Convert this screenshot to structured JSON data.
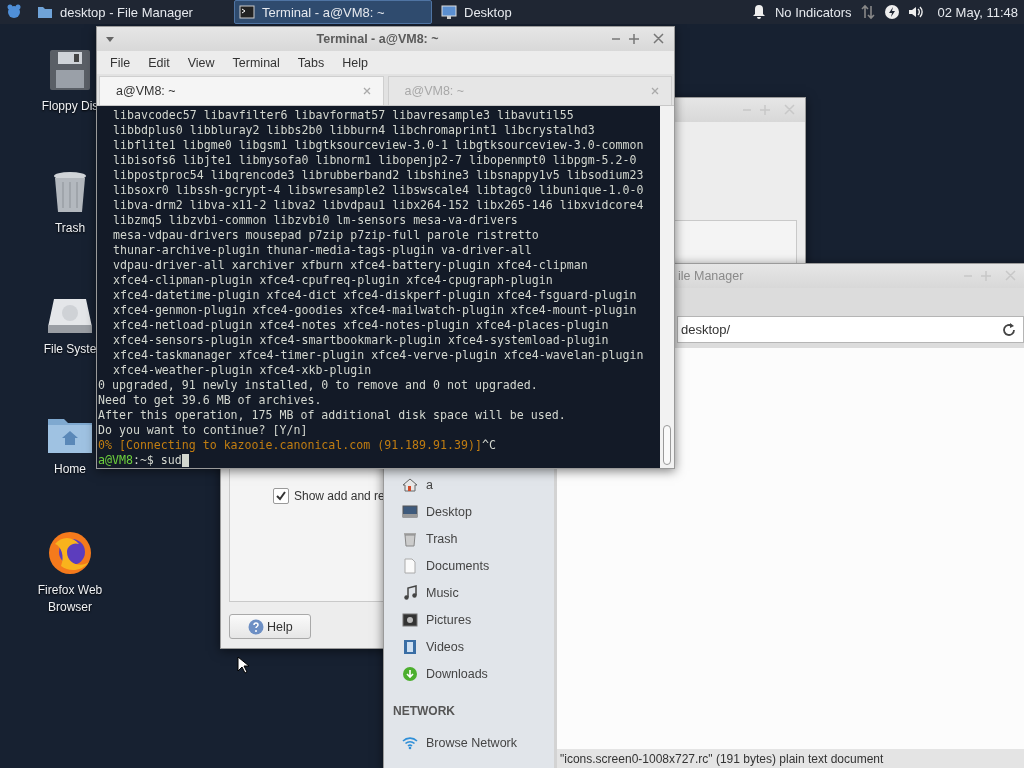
{
  "top_panel": {
    "tasks": [
      {
        "label": "desktop - File Manager",
        "selected": false,
        "kind": "folder"
      },
      {
        "label": "Terminal - a@VM8: ~",
        "selected": true,
        "kind": "terminal"
      },
      {
        "label": "Desktop",
        "selected": false,
        "kind": "desktop"
      }
    ],
    "indicator_label": "No Indicators",
    "clock": "02 May, 11:48"
  },
  "desktop_icons": [
    {
      "label": "Floppy Dis",
      "kind": "floppy"
    },
    {
      "label": "Trash",
      "kind": "trash"
    },
    {
      "label": "File Syste",
      "kind": "drive"
    },
    {
      "label": "Home",
      "kind": "home"
    },
    {
      "label": "Firefox Web Browser",
      "kind": "browser"
    }
  ],
  "settings_window": {
    "checkboxes": [
      {
        "label": "Show add and re",
        "checked": true
      }
    ],
    "help_button": "Help"
  },
  "file_manager": {
    "title": "ile Manager",
    "address": "desktop/",
    "places": [
      {
        "label": "a",
        "kind": "home"
      },
      {
        "label": "Desktop",
        "kind": "desktop"
      },
      {
        "label": "Trash",
        "kind": "trash"
      },
      {
        "label": "Documents",
        "kind": "document"
      },
      {
        "label": "Music",
        "kind": "music"
      },
      {
        "label": "Pictures",
        "kind": "pictures"
      },
      {
        "label": "Videos",
        "kind": "videos"
      },
      {
        "label": "Downloads",
        "kind": "downloads"
      }
    ],
    "network_heading": "NETWORK",
    "network": [
      {
        "label": "Browse Network",
        "kind": "network"
      }
    ],
    "status": "\"icons.screen0-1008x727.rc\" (191 bytes) plain text document"
  },
  "terminal": {
    "title": "Terminal - a@VM8: ~",
    "menu": [
      "File",
      "Edit",
      "View",
      "Terminal",
      "Tabs",
      "Help"
    ],
    "tabs": [
      {
        "label": "a@VM8: ~",
        "selected": true
      },
      {
        "label": "a@VM8: ~",
        "selected": false
      }
    ],
    "lines": [
      {
        "kind": "package",
        "text": "libavcodec57 libavfilter6 libavformat57 libavresample3 libavutil55"
      },
      {
        "kind": "package",
        "text": "libbdplus0 libbluray2 libbs2b0 libburn4 libchromaprint1 libcrystalhd3"
      },
      {
        "kind": "package",
        "text": "libflite1 libgme0 libgsm1 libgtksourceview-3.0-1 libgtksourceview-3.0-common"
      },
      {
        "kind": "package",
        "text": "libisofs6 libjte1 libmysofa0 libnorm1 libopenjp2-7 libopenmpt0 libpgm-5.2-0"
      },
      {
        "kind": "package",
        "text": "libpostproc54 libqrencode3 librubberband2 libshine3 libsnappy1v5 libsodium23"
      },
      {
        "kind": "package",
        "text": "libsoxr0 libssh-gcrypt-4 libswresample2 libswscale4 libtagc0 libunique-1.0-0"
      },
      {
        "kind": "package",
        "text": "libva-drm2 libva-x11-2 libva2 libvdpau1 libx264-152 libx265-146 libxvidcore4"
      },
      {
        "kind": "package",
        "text": "libzmq5 libzvbi-common libzvbi0 lm-sensors mesa-va-drivers"
      },
      {
        "kind": "package",
        "text": "mesa-vdpau-drivers mousepad p7zip p7zip-full parole ristretto"
      },
      {
        "kind": "package",
        "text": "thunar-archive-plugin thunar-media-tags-plugin va-driver-all"
      },
      {
        "kind": "package",
        "text": "vdpau-driver-all xarchiver xfburn xfce4-battery-plugin xfce4-clipman"
      },
      {
        "kind": "package",
        "text": "xfce4-clipman-plugin xfce4-cpufreq-plugin xfce4-cpugraph-plugin"
      },
      {
        "kind": "package",
        "text": "xfce4-datetime-plugin xfce4-dict xfce4-diskperf-plugin xfce4-fsguard-plugin"
      },
      {
        "kind": "package",
        "text": "xfce4-genmon-plugin xfce4-goodies xfce4-mailwatch-plugin xfce4-mount-plugin"
      },
      {
        "kind": "package",
        "text": "xfce4-netload-plugin xfce4-notes xfce4-notes-plugin xfce4-places-plugin"
      },
      {
        "kind": "package",
        "text": "xfce4-sensors-plugin xfce4-smartbookmark-plugin xfce4-systemload-plugin"
      },
      {
        "kind": "package",
        "text": "xfce4-taskmanager xfce4-timer-plugin xfce4-verve-plugin xfce4-wavelan-plugin"
      },
      {
        "kind": "package",
        "text": "xfce4-weather-plugin xfce4-xkb-plugin"
      },
      {
        "kind": "plain",
        "text": "0 upgraded, 91 newly installed, 0 to remove and 0 not upgraded."
      },
      {
        "kind": "plain",
        "text": "Need to get 39.6 MB of archives."
      },
      {
        "kind": "plain",
        "text": "After this operation, 175 MB of additional disk space will be used."
      },
      {
        "kind": "plain",
        "text": "Do you want to continue? [Y/n]"
      },
      {
        "kind": "progress",
        "text": "0% [Connecting to kazooie.canonical.com (91.189.91.39)]",
        "suffix": "^C"
      },
      {
        "kind": "prompt",
        "user": "a@VM8",
        "text": ":~$ sud"
      }
    ]
  }
}
